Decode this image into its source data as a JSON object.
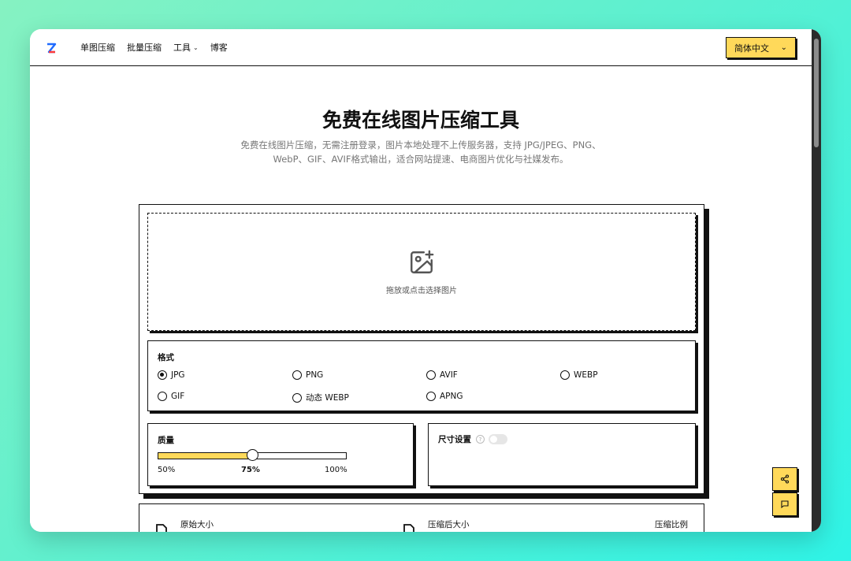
{
  "nav": {
    "items": [
      {
        "label": "单图压缩"
      },
      {
        "label": "批量压缩"
      },
      {
        "label": "工具",
        "has_dropdown": true
      },
      {
        "label": "博客"
      }
    ],
    "language": "简体中文"
  },
  "hero": {
    "title": "免费在线图片压缩工具",
    "desc_line1": "免费在线图片压缩，无需注册登录，图片本地处理不上传服务器，支持 JPG/JPEG、PNG、",
    "desc_line2": "WebP、GIF、AVIF格式输出，适合网站提速、电商图片优化与社媒发布。"
  },
  "upload": {
    "text": "拖放或点击选择图片",
    "icon": "image-add-icon"
  },
  "format": {
    "title": "格式",
    "selected": "JPG",
    "options": [
      "JPG",
      "PNG",
      "AVIF",
      "WEBP",
      "GIF",
      "动态 WEBP",
      "APNG"
    ]
  },
  "quality": {
    "title": "质量",
    "value_percent": 75,
    "min_label": "50%",
    "current_label": "75%",
    "max_label": "100%",
    "min": 50,
    "max": 100
  },
  "size_settings": {
    "title": "尺寸设置",
    "enabled": false,
    "help_icon": "question-circle-icon"
  },
  "stats": {
    "original_label": "原始大小",
    "compressed_label": "压缩后大小",
    "ratio_label": "压缩比例"
  },
  "floating": {
    "share_icon": "share-icon",
    "feedback_icon": "message-icon"
  },
  "colors": {
    "accent": "#ffd95a",
    "border": "#111111"
  }
}
